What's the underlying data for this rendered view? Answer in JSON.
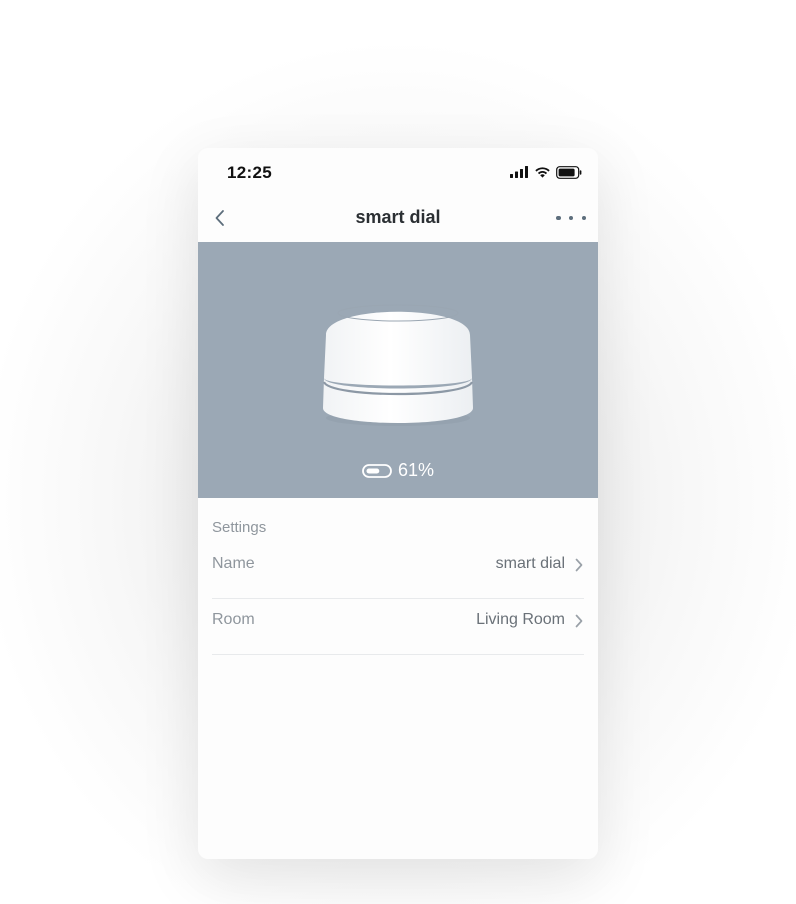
{
  "status_bar": {
    "time": "12:25",
    "icons": [
      "cellular-signal-icon",
      "wifi-icon",
      "battery-icon"
    ]
  },
  "nav": {
    "back_icon": "chevron-left-icon",
    "title": "smart dial",
    "more_icon": "more-horizontal-icon"
  },
  "device": {
    "image": "smart-dial-device",
    "battery_icon": "battery-pill-icon",
    "battery_text": "61%",
    "battery_level": 0.61
  },
  "settings": {
    "header": "Settings",
    "rows": [
      {
        "label": "Name",
        "value": "smart dial",
        "icon": "chevron-right-icon"
      },
      {
        "label": "Room",
        "value": "Living Room",
        "icon": "chevron-right-icon"
      }
    ]
  },
  "colors": {
    "hero_background": "#9ba8b5",
    "accent_icon": "#5d6e7c",
    "label_gray": "#8f969d",
    "value_gray": "#6a7178"
  }
}
